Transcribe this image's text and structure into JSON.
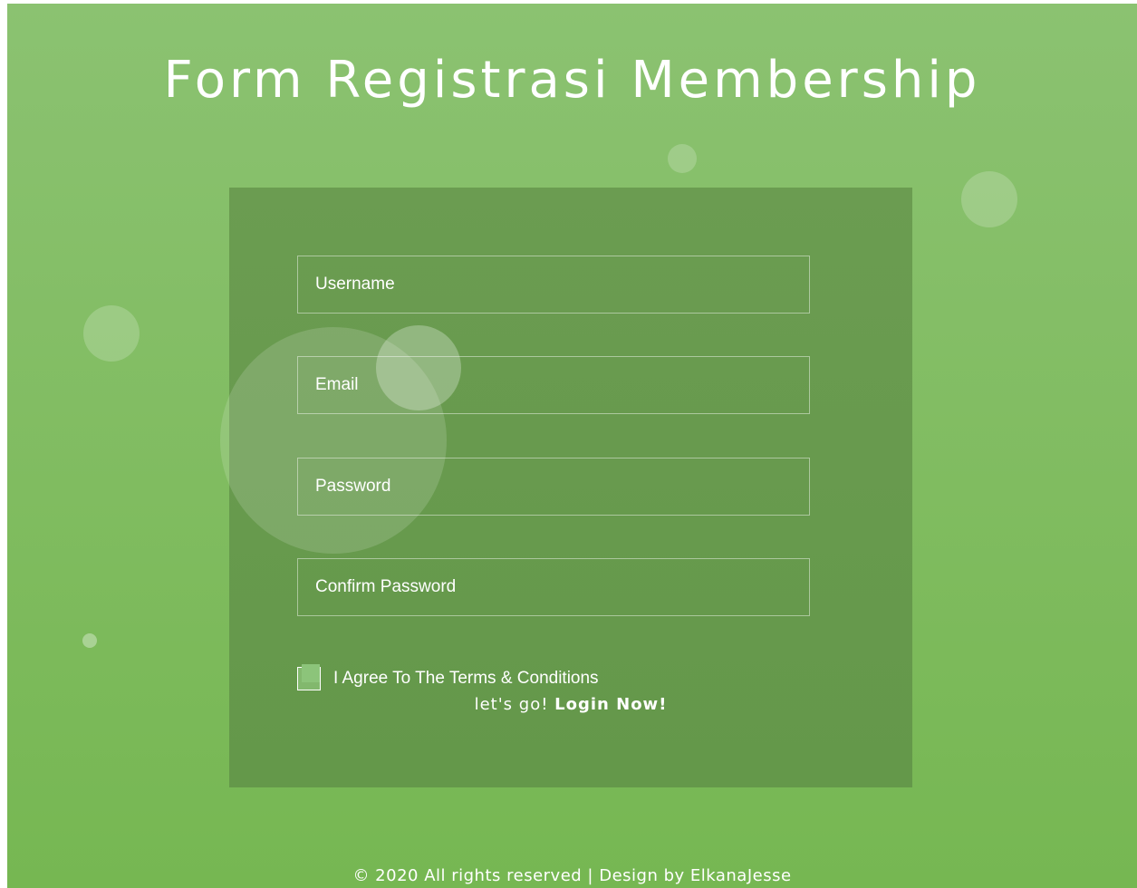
{
  "header": {
    "title": "Form Registrasi Membership"
  },
  "form": {
    "username_placeholder": "Username",
    "email_placeholder": "Email",
    "password_placeholder": "Password",
    "confirm_password_placeholder": "Confirm Password",
    "agree_label": "I Agree To The Terms & Conditions",
    "agree_checked": false,
    "login_prefix": "let's go! ",
    "login_link": "Login Now!"
  },
  "footer": {
    "text": "© 2020 All rights reserved | Design by ElkanaJesse"
  },
  "colors": {
    "background_top": "#8bc271",
    "background_bottom": "#76b752",
    "panel": "#679b4d",
    "text": "#ffffff"
  }
}
